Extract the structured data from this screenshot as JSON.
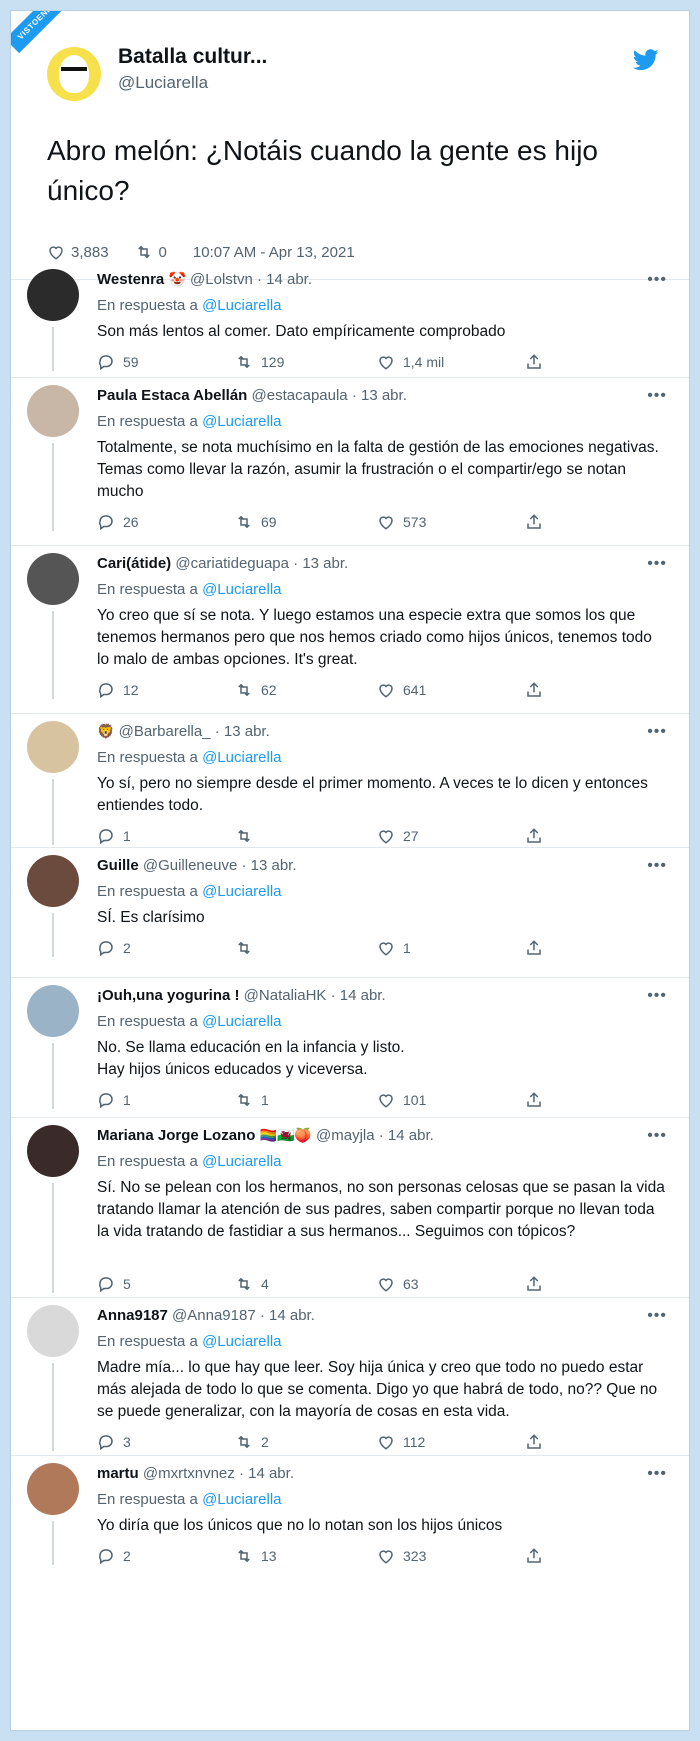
{
  "watermark": "VISTOENLASREDES.COM",
  "author": {
    "name": "Batalla cultur...",
    "handle": "@Luciarella"
  },
  "tweet": {
    "text": "Abro melón: ¿Notáis cuando la gente es hijo único?",
    "likes": "3,883",
    "retweets": "0",
    "timestamp": "10:07 AM - Apr 13, 2021"
  },
  "replies": [
    {
      "name": "Westenra",
      "emoji": "🤡",
      "handle": "@Lolstvn",
      "date": "· 14 abr.",
      "in_reply_prefix": "En respuesta a",
      "mention": "@Luciarella",
      "text": "Son más lentos al comer. Dato empíricamente comprobado",
      "replies": "59",
      "retweets": "129",
      "likes": "1,4 mil"
    },
    {
      "name": "Paula Estaca Abellán",
      "emoji": "",
      "handle": "@estacapaula",
      "date": "· 13 abr.",
      "in_reply_prefix": "En respuesta a",
      "mention": "@Luciarella",
      "text": "Totalmente, se nota muchísimo en la falta de gestión de las emociones negativas. Temas como llevar la razón, asumir la frustración o el compartir/ego se notan mucho",
      "replies": "26",
      "retweets": "69",
      "likes": "573"
    },
    {
      "name": "Cari(átide)",
      "emoji": "",
      "handle": "@cariatideguapa",
      "date": "· 13 abr.",
      "in_reply_prefix": "En respuesta a",
      "mention": "@Luciarella",
      "text": "Yo creo que sí se nota. Y luego estamos una especie extra que somos los que tenemos hermanos pero que nos hemos criado como hijos únicos, tenemos todo lo malo de ambas opciones. It's great.",
      "replies": "12",
      "retweets": "62",
      "likes": "641"
    },
    {
      "name": "",
      "emoji": "🦁",
      "handle": "@Barbarella_",
      "date": "· 13 abr.",
      "in_reply_prefix": "En respuesta a",
      "mention": "@Luciarella",
      "text": "Yo sí, pero no siempre desde el primer momento. A veces te lo dicen y entonces entiendes todo.",
      "replies": "1",
      "retweets": "",
      "likes": "27"
    },
    {
      "name": "Guille",
      "emoji": "",
      "handle": "@Guilleneuve",
      "date": "· 13 abr.",
      "in_reply_prefix": "En respuesta a",
      "mention": "@Luciarella",
      "text": "SÍ. Es clarísimo",
      "replies": "2",
      "retweets": "",
      "likes": "1"
    },
    {
      "name": "¡Ouh,una yogurina !",
      "emoji": "",
      "handle": "@NataliaHK",
      "date": "· 14 abr.",
      "in_reply_prefix": "En respuesta a",
      "mention": "@Luciarella",
      "text": "No. Se llama educación en la infancia y listo.\nHay hijos únicos educados y viceversa.",
      "replies": "1",
      "retweets": "1",
      "likes": "101"
    },
    {
      "name": "Mariana Jorge Lozano",
      "emoji": "🏳️‍🌈🏴󠁧󠁢󠁷󠁬󠁳󠁿🍑",
      "handle": "@mayjla",
      "date": "· 14 abr.",
      "in_reply_prefix": "En respuesta a",
      "mention": "@Luciarella",
      "text": "Sí. No se pelean con los hermanos, no son personas celosas que se pasan la vida tratando llamar la atención de sus padres, saben compartir porque no llevan toda la vida tratando de fastidiar a sus hermanos... Seguimos con tópicos?",
      "replies": "5",
      "retweets": "4",
      "likes": "63"
    },
    {
      "name": "Anna9187",
      "emoji": "",
      "handle": "@Anna9187",
      "date": "· 14 abr.",
      "in_reply_prefix": "En respuesta a",
      "mention": "@Luciarella",
      "text": "Madre mía... lo que hay que leer. Soy hija única y creo que todo no puedo estar más alejada de todo lo que se comenta. Digo yo que habrá de todo, no?? Que no se puede generalizar, con la mayoría de cosas en esta vida.",
      "replies": "3",
      "retweets": "2",
      "likes": "112"
    },
    {
      "name": "martu",
      "emoji": "",
      "handle": "@mxrtxnvnez",
      "date": "· 14 abr.",
      "in_reply_prefix": "En respuesta a",
      "mention": "@Luciarella",
      "text": "Yo diría que los únicos que no lo notan son los hijos únicos",
      "replies": "2",
      "retweets": "13",
      "likes": "323"
    }
  ],
  "colors": {
    "accent": "#1d9bf0",
    "muted": "#536471",
    "text": "#0f1419"
  }
}
